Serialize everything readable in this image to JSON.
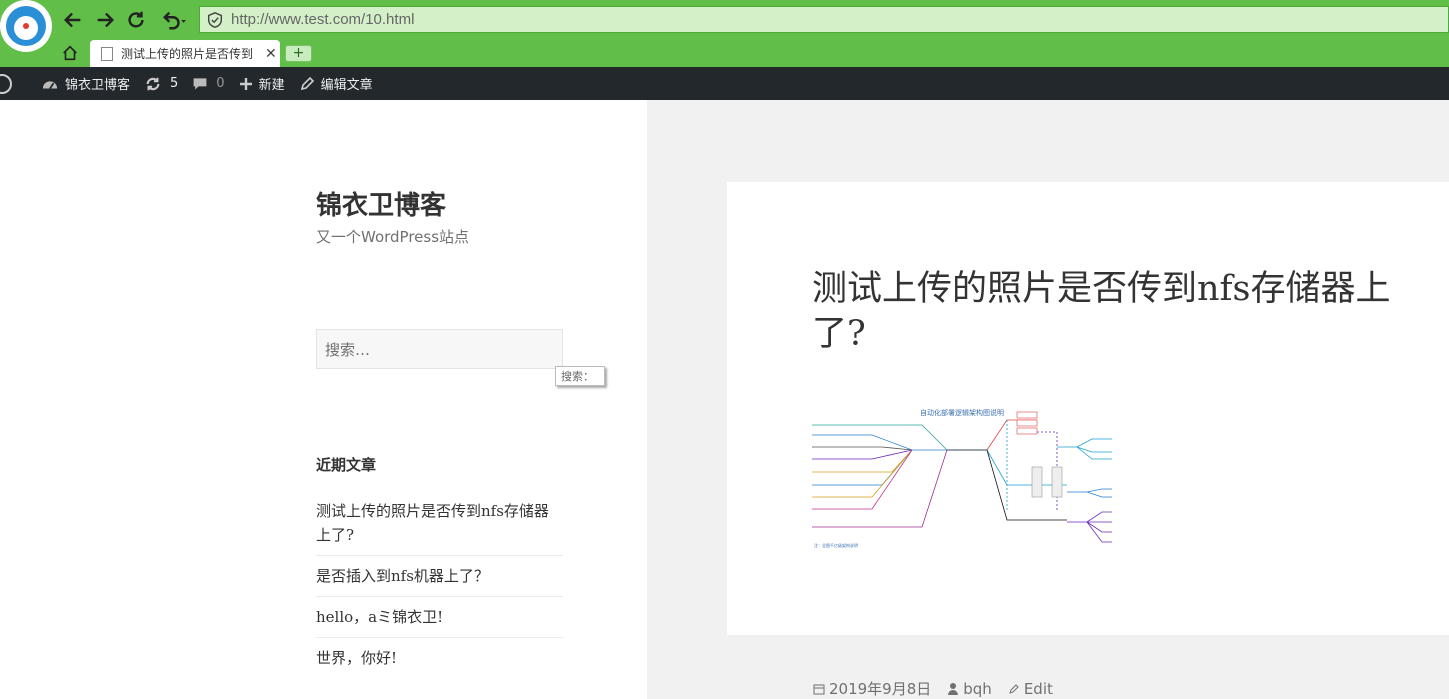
{
  "browser": {
    "url": "http://www.test.com/10.html",
    "tab_title": "测试上传的照片是否传到",
    "new_tab_label": "+"
  },
  "admin_bar": {
    "site_name": "锦衣卫博客",
    "updates_count": "5",
    "comments_count": "0",
    "new_label": "新建",
    "edit_label": "编辑文章"
  },
  "sidebar": {
    "site_title": "锦衣卫博客",
    "site_description": "又一个WordPress站点",
    "search_placeholder": "搜索…",
    "search_tooltip": "搜索：",
    "recent_title": "近期文章",
    "recent_posts": [
      "测试上传的照片是否传到nfs存储器上了?",
      "是否插入到nfs机器上了？",
      "hello，aミ锦衣卫!",
      "世界，你好!"
    ]
  },
  "article": {
    "title": "测试上传的照片是否传到nfs存储器上了?",
    "diagram_title": "自动化部署逻辑架构图说明",
    "date": "2019年9月8日",
    "author": "bqh",
    "edit_label": "Edit"
  },
  "colors": {
    "chrome_green": "#60be49",
    "admin_bar": "#23282d",
    "url_bg": "#d4f0c9"
  }
}
